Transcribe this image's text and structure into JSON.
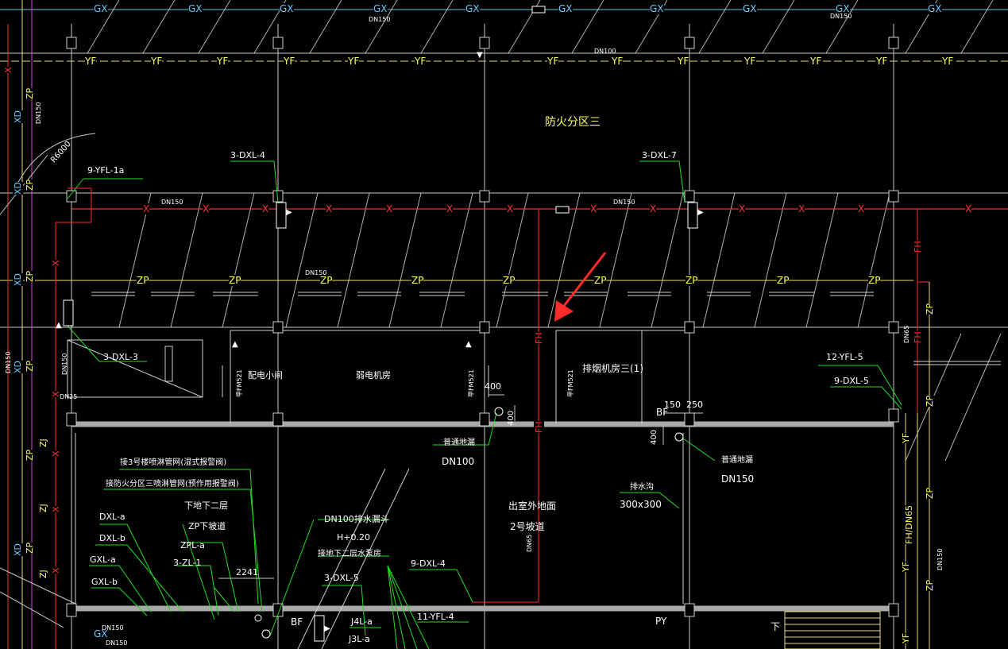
{
  "drawing": {
    "zone_title": "防火分区三",
    "rooms": {
      "power_room": "配电小间",
      "weak_room": "弱电机房",
      "smoke_room": "排烟机房三(1)",
      "door_code": "甲FM521",
      "outdoor_ground": "出室外地面",
      "ramp": "2号坡道",
      "bf": "BF",
      "py": "PY",
      "down_label": "下"
    },
    "pipe_labels": {
      "gx": "GX",
      "yf": "YF",
      "zp": "ZP",
      "x": "X",
      "fh": "FH",
      "xd": "XD",
      "zj": "ZJ"
    },
    "sizes": {
      "dn150": "DN150",
      "dn100": "DN100",
      "dn65": "DN65",
      "dn25": "DN25",
      "r6000": "R6000"
    },
    "callouts": [
      "3-DXL-4",
      "3-DXL-7",
      "9-YFL-1a",
      "3-DXL-3",
      "12-YFL-5",
      "9-DXL-5",
      "9-DXL-4",
      "3-DXL-5",
      "11-YFL-4",
      "J4L-a",
      "J3L-a",
      "DXL-a",
      "DXL-b",
      "GXL-a",
      "GXL-b",
      "ZPL-a",
      "3-ZL-1"
    ],
    "notes": {
      "floor_drain_1": "普通地漏",
      "floor_drain_2": "普通地漏",
      "dn100_text": "DN100",
      "dn150_text": "DN150",
      "drain_channel": "排水沟",
      "channel_size": "300x300",
      "connect_3": "接3号楼喷淋管网(湿式报警阀)",
      "connect_zone3": "接防火分区三喷淋管网(预作用报警阀)",
      "down2": "下地下二层",
      "zp_ramp": "ZP下坡道",
      "dn100_funnel": "DN100排水漏斗",
      "h_level": "H+0.20",
      "pump_room": "接地下二层水泵房",
      "dim_2241": "2241",
      "dim_400a": "400",
      "dim_400b": "400",
      "dim_400c": "400",
      "dim_150": "150",
      "dim_250": "250",
      "fh_dn65": "FH/DN65"
    }
  }
}
